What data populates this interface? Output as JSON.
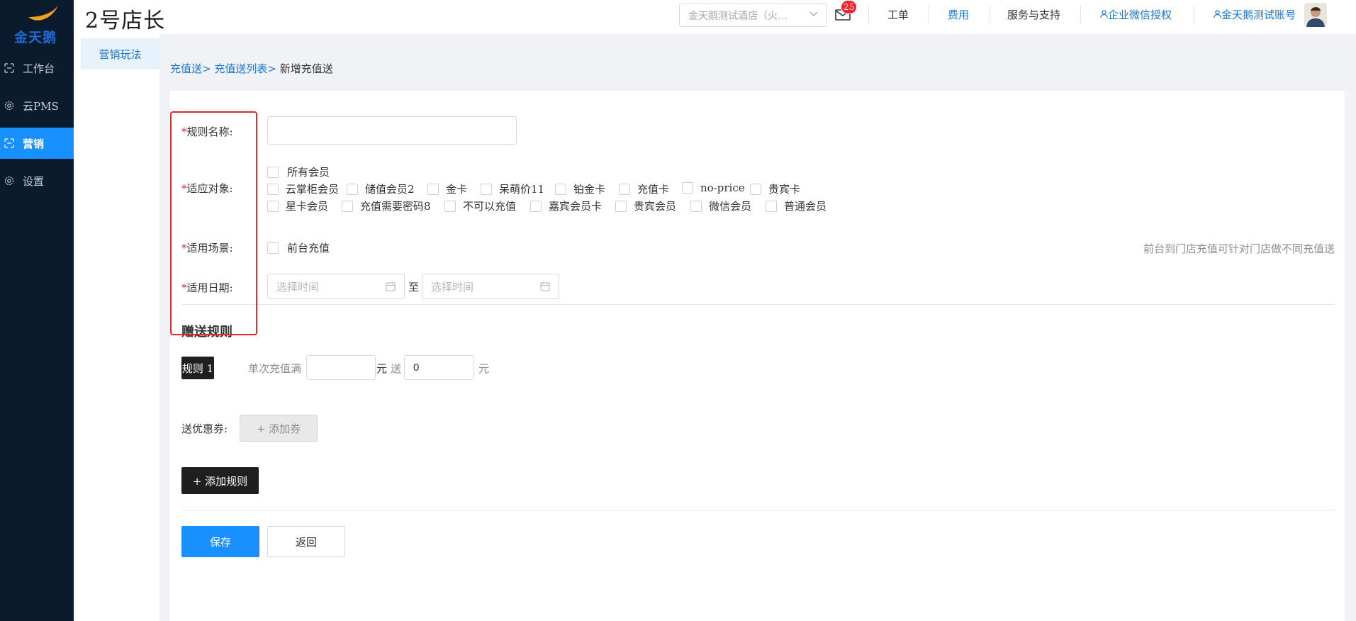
{
  "logo": {
    "text": "金天鹅"
  },
  "nav": {
    "items": [
      {
        "label": "工作台",
        "icon": "workbench-icon"
      },
      {
        "label": "云PMS",
        "icon": "gear-icon"
      },
      {
        "label": "营销",
        "icon": "marketing-icon",
        "active": true
      },
      {
        "label": "设置",
        "icon": "gear-icon"
      }
    ]
  },
  "subnav": {
    "item": "营销玩法"
  },
  "header": {
    "title": "2号店长",
    "hotel_select": "金天鹅测试酒店（火…",
    "mail_badge": "25",
    "work_order": "工单",
    "fees": "费用",
    "support": "服务与支持",
    "wecom_auth": "企业微信授权",
    "account": "金天鹅测试账号"
  },
  "breadcrumb": {
    "crumb1": "充值送",
    "crumb2": "充值送列表",
    "current": "新增充值送",
    "sep": ">"
  },
  "form": {
    "required_mark": "*",
    "rule_name_label": "规则名称:",
    "rule_name_value": "",
    "target_label": "适应对象:",
    "members_all": "所有会员",
    "members": [
      [
        "云掌柜会员",
        "储值会员2",
        "金卡",
        "呆萌价11",
        "铂金卡",
        "充值卡",
        "no-price",
        "贵宾卡"
      ],
      [
        "星卡会员",
        "充值需要密码8",
        "不可以充值",
        "嘉宾会员卡",
        "贵宾会员",
        "微信会员",
        "普通会员"
      ]
    ],
    "scene_label": "适用场景:",
    "scene_option": "前台充值",
    "scene_hint": "前台到门店充值可针对门店做不同充值送",
    "date_label": "适用日期:",
    "date_start_placeholder": "选择时间",
    "date_end_placeholder": "选择时间",
    "date_sep": "至"
  },
  "gift": {
    "title": "赠送规则",
    "rule_tag": "规则 1",
    "single_recharge": "单次充值满",
    "threshold_value": "",
    "unit1": "元",
    "give": "送",
    "give_value": "0",
    "unit2": "元",
    "coupon_label": "送优惠券:",
    "add_coupon": "+ 添加券",
    "add_rule": "+ 添加规则"
  },
  "actions": {
    "save": "保存",
    "back": "返回"
  },
  "colors": {
    "primary": "#1890ff",
    "sidebar": "#0b1b2e",
    "required": "#f5222d",
    "highlight": "#e5262b"
  }
}
